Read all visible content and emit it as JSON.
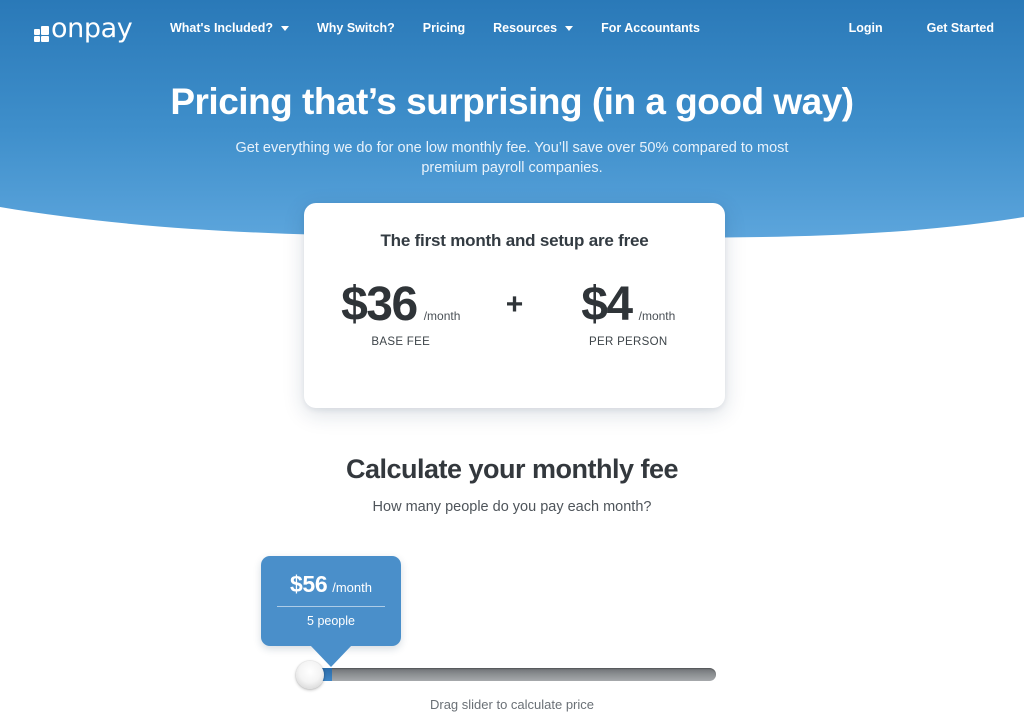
{
  "brand": {
    "logo_text": "onpay",
    "accent_blue": "#4a8fca",
    "hero_top_blue": "#2a7ab9",
    "hero_bottom_blue": "#5ba4dc"
  },
  "nav": {
    "items": [
      {
        "label": "What's Included?",
        "has_caret": true
      },
      {
        "label": "Why Switch?",
        "has_caret": false
      },
      {
        "label": "Pricing",
        "has_caret": false
      },
      {
        "label": "Resources",
        "has_caret": true
      },
      {
        "label": "For Accountants",
        "has_caret": false
      }
    ],
    "login_label": "Login",
    "get_started_label": "Get Started"
  },
  "hero": {
    "headline": "Pricing that’s surprising (in a good way)",
    "subhead": "Get everything we do for one low monthly fee. You’ll save over 50% compared to most premium payroll companies."
  },
  "price_card": {
    "title": "The first month and setup are free",
    "base": {
      "amount": "$36",
      "per": "/month",
      "label": "BASE FEE"
    },
    "operator": "+",
    "person": {
      "amount": "$4",
      "per": "/month",
      "label": "PER PERSON"
    }
  },
  "calculator": {
    "title": "Calculate your monthly fee",
    "subtitle": "How many people do you pay each month?",
    "tooltip": {
      "amount": "$56",
      "per": "/month",
      "people": "5 people"
    },
    "slider": {
      "caption": "Drag slider to calculate price",
      "value_percent": 0
    }
  }
}
